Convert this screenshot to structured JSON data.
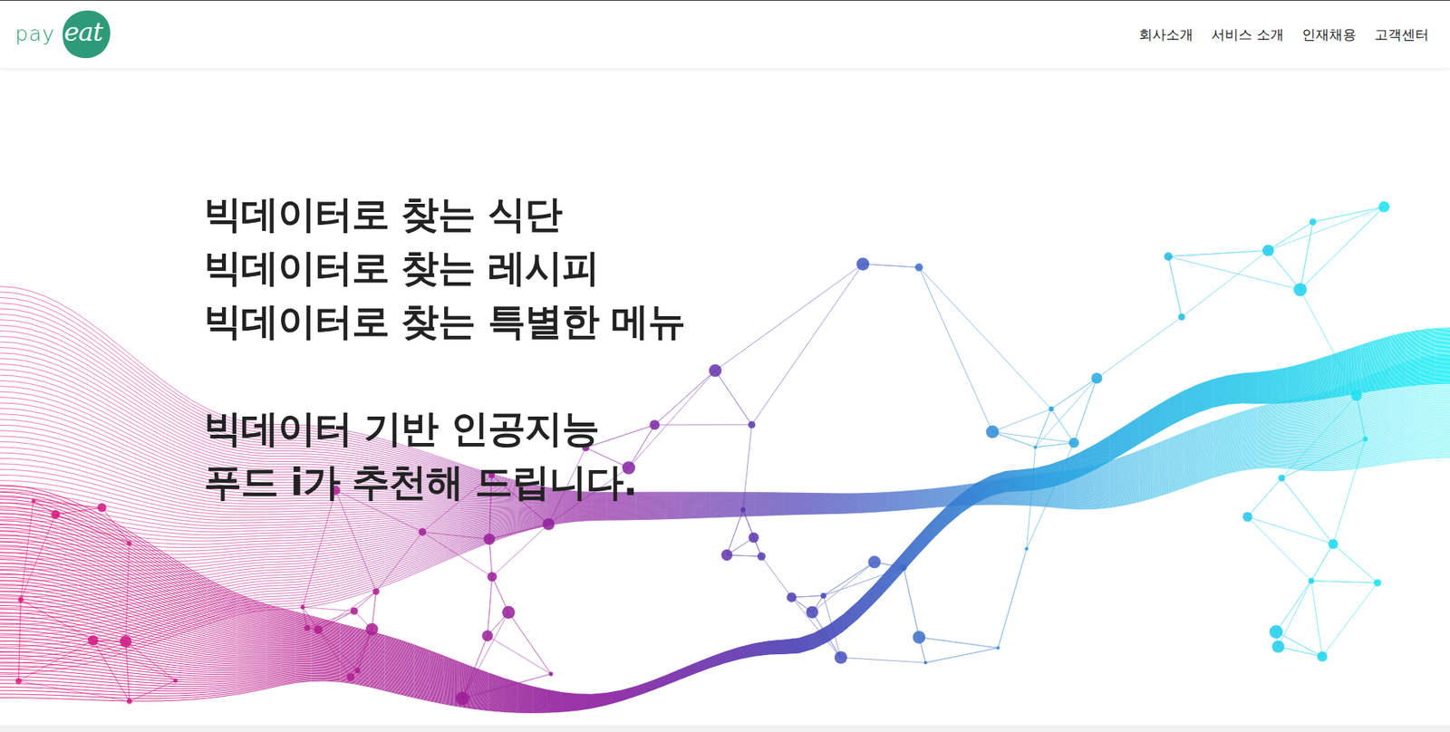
{
  "logo": {
    "prefix": "pay",
    "mark": "eat"
  },
  "nav": {
    "items": [
      {
        "label": "회사소개"
      },
      {
        "label": "서비스 소개"
      },
      {
        "label": "인재채용"
      },
      {
        "label": "고객센터"
      }
    ]
  },
  "hero": {
    "lines": [
      "빅데이터로 찾는 식단",
      "빅데이터로 찾는 레시피",
      "빅데이터로 찾는 특별한 메뉴"
    ],
    "tagline": [
      "빅데이터 기반 인공지능",
      "푸드 i가 추천해 드립니다."
    ]
  }
}
